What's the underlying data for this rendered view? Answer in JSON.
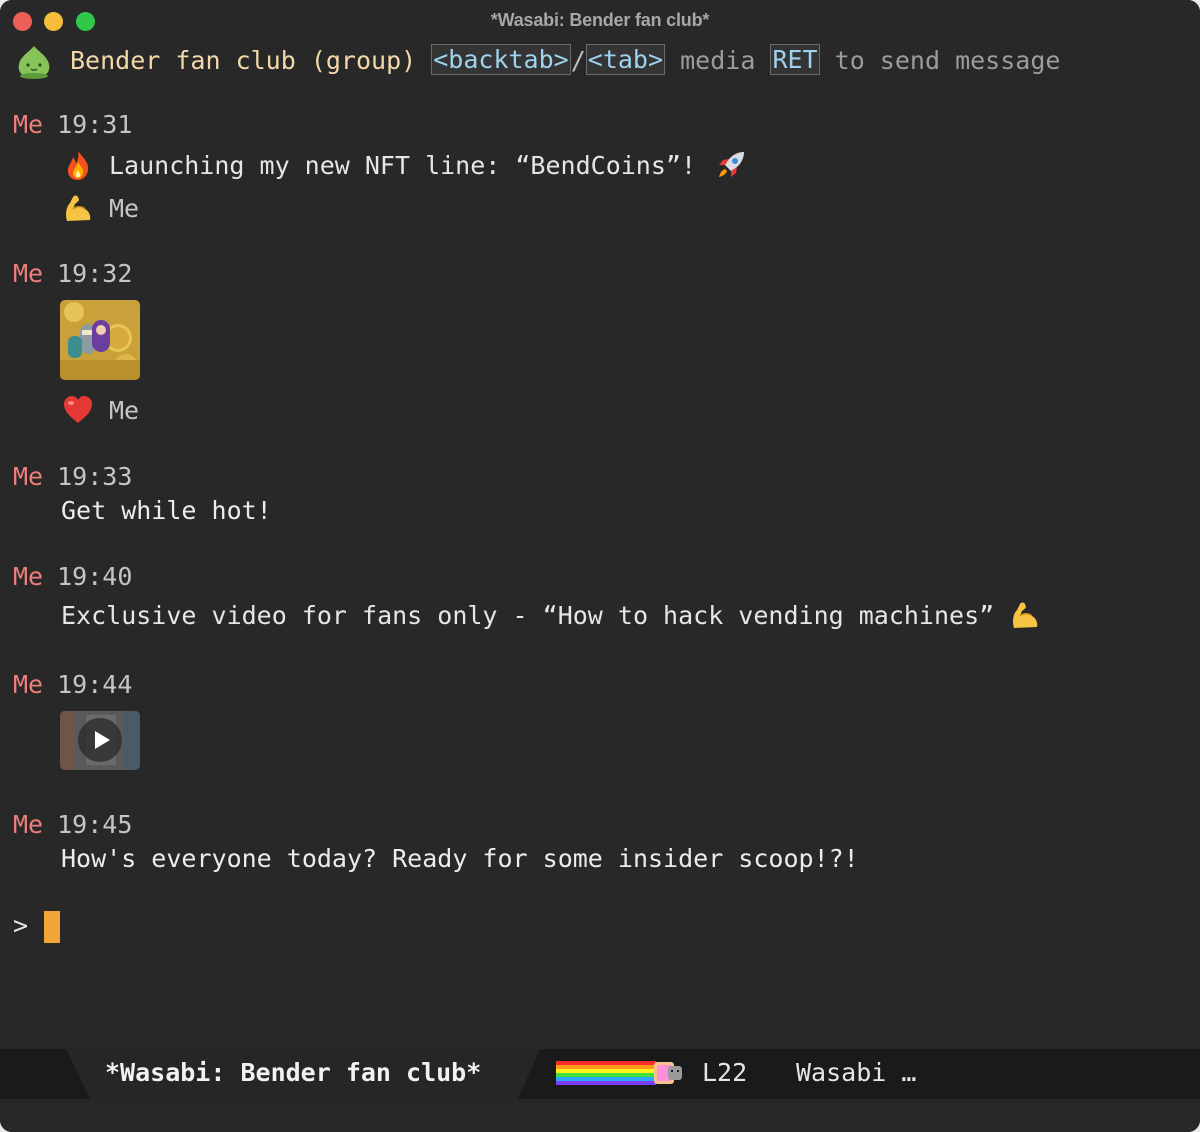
{
  "window": {
    "title": "*Wasabi: Bender fan club*"
  },
  "header": {
    "chat_name": "Bender fan club (group)",
    "key_backtab": "<backtab>",
    "slash": "/",
    "key_tab": "<tab>",
    "media_text": "media",
    "key_ret": "RET",
    "send_text": "to send message"
  },
  "messages": [
    {
      "sender": "Me",
      "time": "19:31",
      "text": "Launching my new NFT line: “BendCoins”!",
      "lead_icon": "fire-icon",
      "trail_icon": "rocket-icon",
      "reaction": {
        "icon": "flexed-biceps-icon",
        "by": "Me"
      }
    },
    {
      "sender": "Me",
      "time": "19:32",
      "media": "image",
      "reaction": {
        "icon": "red-heart-icon",
        "by": "Me"
      }
    },
    {
      "sender": "Me",
      "time": "19:33",
      "text": "Get while hot!"
    },
    {
      "sender": "Me",
      "time": "19:40",
      "text": "Exclusive video for fans only - “How to hack vending machines”",
      "trail_icon": "flexed-biceps-icon"
    },
    {
      "sender": "Me",
      "time": "19:44",
      "media": "video"
    },
    {
      "sender": "Me",
      "time": "19:45",
      "text": "How's everyone today? Ready for some insider scoop!?!"
    }
  ],
  "input": {
    "prompt": ">"
  },
  "modeline": {
    "buffer_name": "*Wasabi: Bender fan club*",
    "line": "L22",
    "mode": "Wasabi …"
  },
  "colors": {
    "background": "#282828",
    "sender": "#ec7f7b",
    "chat_name": "#f3d9a9",
    "keycap": "#9fd2ee",
    "cursor": "#f4a53a"
  }
}
